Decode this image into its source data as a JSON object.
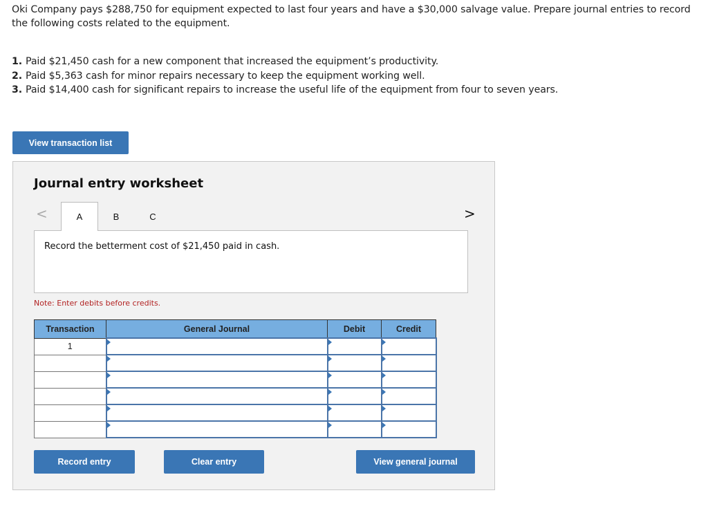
{
  "problem": {
    "intro": "Oki Company pays $288,750 for equipment expected to last four years and have a $30,000 salvage value. Prepare journal entries to record the following costs related to the equipment.",
    "items": [
      {
        "num": "1.",
        "text": "Paid $21,450 cash for a new component that increased the equipment’s productivity."
      },
      {
        "num": "2.",
        "text": "Paid $5,363 cash for minor repairs necessary to keep the equipment working well."
      },
      {
        "num": "3.",
        "text": "Paid $14,400 cash for significant repairs to increase the useful life of the equipment from four to seven years."
      }
    ]
  },
  "buttons": {
    "view_transaction_list": "View transaction list",
    "record_entry": "Record entry",
    "clear_entry": "Clear entry",
    "view_general_journal": "View general journal"
  },
  "worksheet": {
    "title": "Journal entry worksheet",
    "prev_icon": "<",
    "next_icon": ">",
    "tabs": [
      {
        "label": "A",
        "active": true
      },
      {
        "label": "B",
        "active": false
      },
      {
        "label": "C",
        "active": false
      }
    ],
    "prompt": "Record the betterment cost of $21,450 paid in cash.",
    "note": "Note: Enter debits before credits."
  },
  "journal_table": {
    "headers": [
      "Transaction",
      "General Journal",
      "Debit",
      "Credit"
    ],
    "rows": [
      {
        "transaction": "1",
        "account": "",
        "debit": "",
        "credit": ""
      },
      {
        "transaction": "",
        "account": "",
        "debit": "",
        "credit": ""
      },
      {
        "transaction": "",
        "account": "",
        "debit": "",
        "credit": ""
      },
      {
        "transaction": "",
        "account": "",
        "debit": "",
        "credit": ""
      },
      {
        "transaction": "",
        "account": "",
        "debit": "",
        "credit": ""
      },
      {
        "transaction": "",
        "account": "",
        "debit": "",
        "credit": ""
      }
    ]
  },
  "colors": {
    "button_blue": "#3a76b5",
    "header_blue": "#76aee0",
    "note_red": "#b22222",
    "panel_bg": "#f2f2f2"
  }
}
